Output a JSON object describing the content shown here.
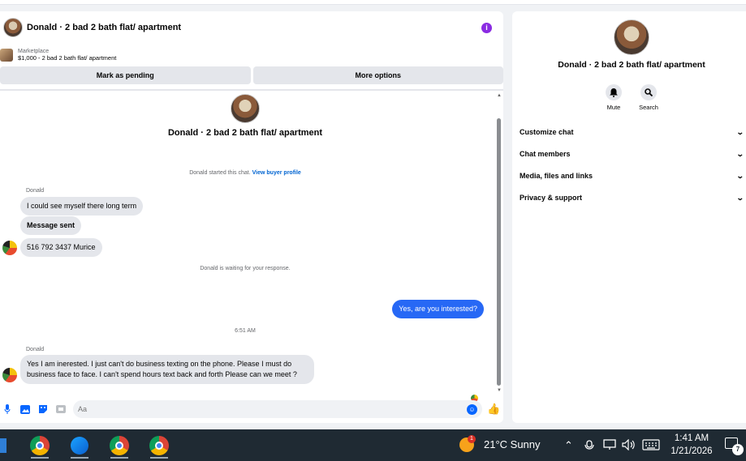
{
  "chat": {
    "title": "Donald · 2 bad 2 bath flat/ apartment",
    "info_icon": "i",
    "marketplace_label": "Marketplace",
    "listing": "$1,000 - 2 bad 2 bath flat/ apartment",
    "mark_pending": "Mark as pending",
    "more_options": "More options",
    "hero_name": "Donald · 2 bad 2 bath flat/ apartment",
    "started_text": "Donald started this chat.",
    "view_buyer_profile": "View buyer profile",
    "messages": [
      {
        "sender": "Donald",
        "text": "I could see myself there long term"
      },
      {
        "text": "Message sent"
      },
      {
        "text": "516 792 3437 Murice"
      },
      {
        "text": "Yes, are you interested?",
        "outgoing": true
      },
      {
        "sender": "Donald",
        "text": "Yes I am inerested. I just can't do business texting on the phone. Please I must do business face to face. I can't  spend hours text back and forth Please can we meet ?"
      }
    ],
    "waiting_text": "Donald is waiting for your response.",
    "timestamp": "6:51 AM",
    "composer_placeholder": "Aa"
  },
  "right_panel": {
    "name": "Donald · 2 bad 2 bath flat/ apartment",
    "mute_label": "Mute",
    "search_label": "Search",
    "sections": [
      "Customize chat",
      "Chat members",
      "Media, files and links",
      "Privacy & support"
    ]
  },
  "taskbar": {
    "weather_badge": "1",
    "weather": "21°C  Sunny",
    "time": "1:41 AM",
    "date": "1/21/2026",
    "notification_count": "7"
  },
  "colors": {
    "accent": "#2768f5",
    "bubble_incoming": "#e4e6eb",
    "taskbar": "#1f2a33"
  }
}
